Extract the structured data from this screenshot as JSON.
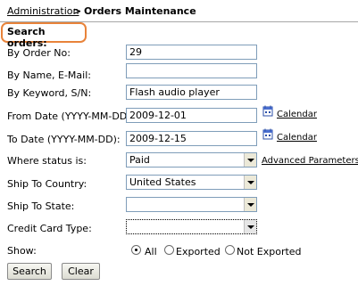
{
  "breadcrumb": {
    "parent": "Administration",
    "separator": ">",
    "current": "Orders Maintenance"
  },
  "section_title": "Search orders:",
  "fields": {
    "order_no": {
      "label": "By Order No:",
      "value": "29"
    },
    "name_email": {
      "label": "By Name, E-Mail:",
      "value": ""
    },
    "keyword": {
      "label": "By Keyword, S/N:",
      "value": "Flash audio player"
    },
    "from_date": {
      "label": "From Date (YYYY-MM-DD):",
      "value": "2009-12-01"
    },
    "to_date": {
      "label": "To Date (YYYY-MM-DD):",
      "value": "2009-12-15"
    },
    "status": {
      "label": "Where status is:",
      "value": "Paid"
    },
    "country": {
      "label": "Ship To Country:",
      "value": "United States"
    },
    "state": {
      "label": "Ship To State:",
      "value": ""
    },
    "card_type": {
      "label": "Credit Card Type:",
      "value": ""
    }
  },
  "calendar_label": "Calendar",
  "advanced_link": "Advanced Parameters",
  "show": {
    "label": "Show:",
    "options": [
      "All",
      "Exported",
      "Not Exported"
    ],
    "selected": "All"
  },
  "buttons": {
    "search": "Search",
    "clear": "Clear"
  },
  "colors": {
    "highlight_border": "#e8833a",
    "input_border": "#7f9db9"
  }
}
